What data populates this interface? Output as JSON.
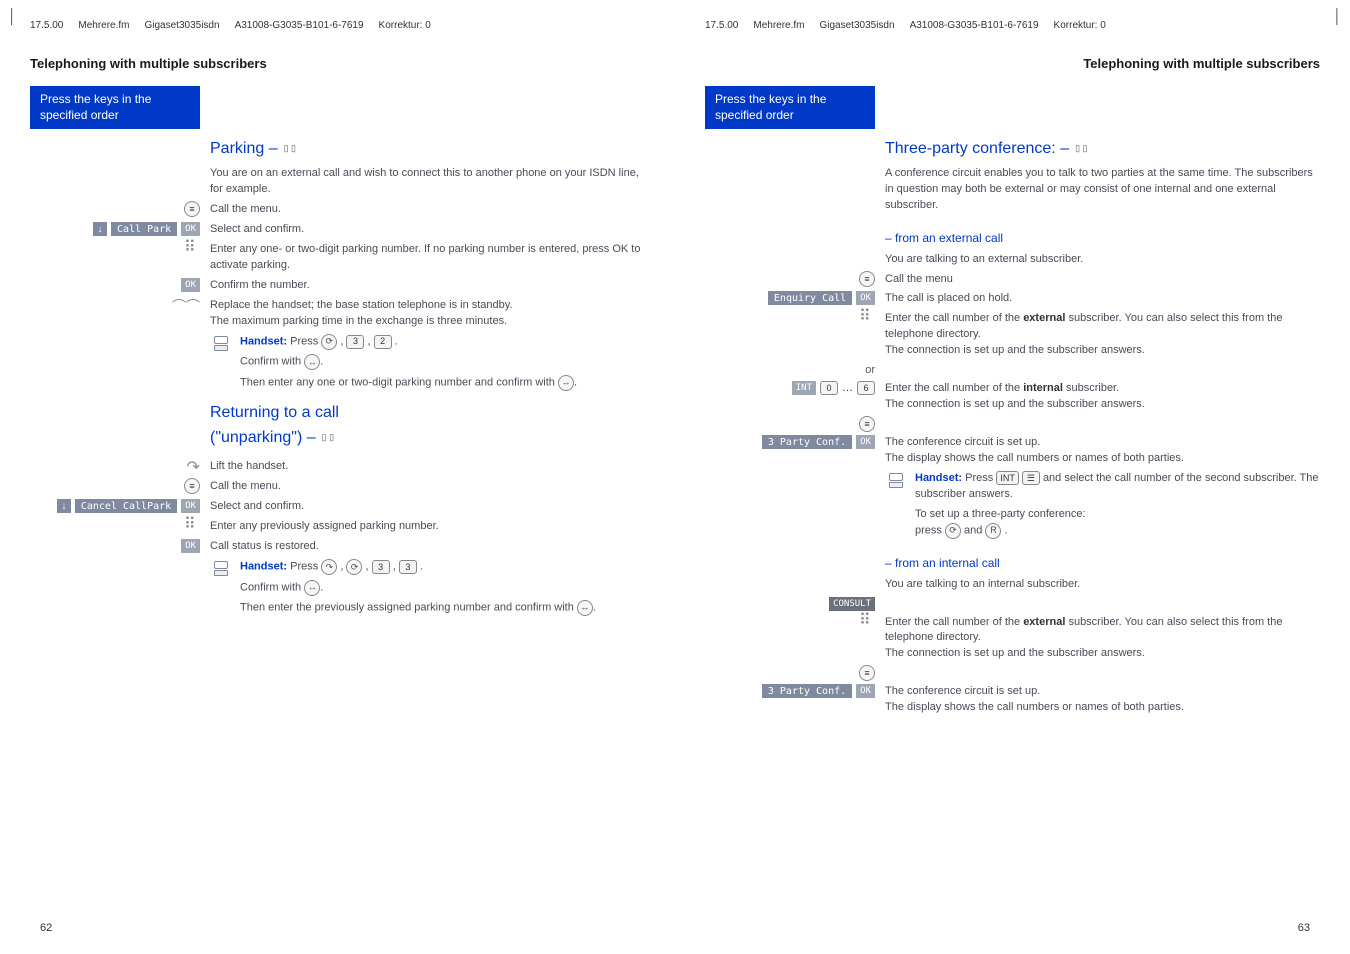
{
  "header": {
    "date": "17.5.00",
    "file": "Mehrere.fm",
    "model": "Gigaset3035isdn",
    "doc_id": "A31008-G3035-B101-6-7619",
    "correction": "Korrektur: 0"
  },
  "section_title": "Telephoning with multiple subscribers",
  "left_box": "Press the keys in the specified order",
  "page_numbers": {
    "left": "62",
    "right": "63"
  },
  "left_page": {
    "h1": "Parking –",
    "p1": "You are on an external call and wish to connect this to another phone on your ISDN line, for example.",
    "menu_call": "Call the menu.",
    "menu_call_park": "Call Park",
    "select_confirm": "Select and confirm.",
    "enter_park_num": "Enter any one- or two-digit parking number. If no parking number is entered, press OK to activate parking.",
    "confirm_num": "Confirm the number.",
    "replace_handset": "Replace the handset; the base station telephone is in standby.",
    "max_parking": "The maximum parking time in the exchange is three minutes.",
    "handset_press": "Press",
    "handset_confirm": "Confirm with",
    "handset_then": "Then enter any one or two-digit parking number and confirm with",
    "h2a": "Returning to a call",
    "h2b": "(\"unparking\") –",
    "lift": "Lift the handset.",
    "menu_cancel": "Cancel CallPark",
    "enter_prev": "Enter any previously assigned parking number.",
    "restored": "Call status is restored.",
    "handset_press2": "Press",
    "handset_then2": "Then enter the previously assigned parking number and confirm with"
  },
  "right_page": {
    "h1": "Three-party conference: –",
    "p1": "A conference circuit enables you to talk to two parties at the same time. The subscribers in question may both be external or may consist of one internal and one external subscriber.",
    "sub1": "– from an external call",
    "talking_ext": "You are talking to an external subscriber.",
    "call_menu": "Call the menu",
    "enquiry": "Enquiry Call",
    "on_hold": "The call is placed on hold.",
    "enter_ext": "Enter the call number of the ",
    "enter_ext_b": "external",
    "enter_ext_2": " subscriber. You can also select this from the telephone directory.",
    "conn_sub": "The connection is set up and the subscriber answers.",
    "or": "or",
    "enter_int": "Enter the call number of the ",
    "enter_int_b": "internal",
    "enter_int_2": " subscriber.",
    "conf_label": "3 Party Conf.",
    "conf_set": "The conference circuit is set up.",
    "display_shows": "The display shows the call numbers or names of both parties.",
    "handset_press": "Press",
    "handset_select": "and select the call number of the second subscriber. The subscriber answers.",
    "handset_setup": "To set up a three-party conference:",
    "press_and": "press",
    "and": "and",
    "sub2": "– from an internal call",
    "talking_int": "You are talking to an internal subscriber.",
    "consult": "CONSULT",
    "conf_set2": "The conference circuit is set up.",
    "display_shows2": "The display shows the call numbers or names of both parties."
  },
  "labels": {
    "ok": "OK",
    "handset": "Handset:",
    "int": "INT"
  }
}
